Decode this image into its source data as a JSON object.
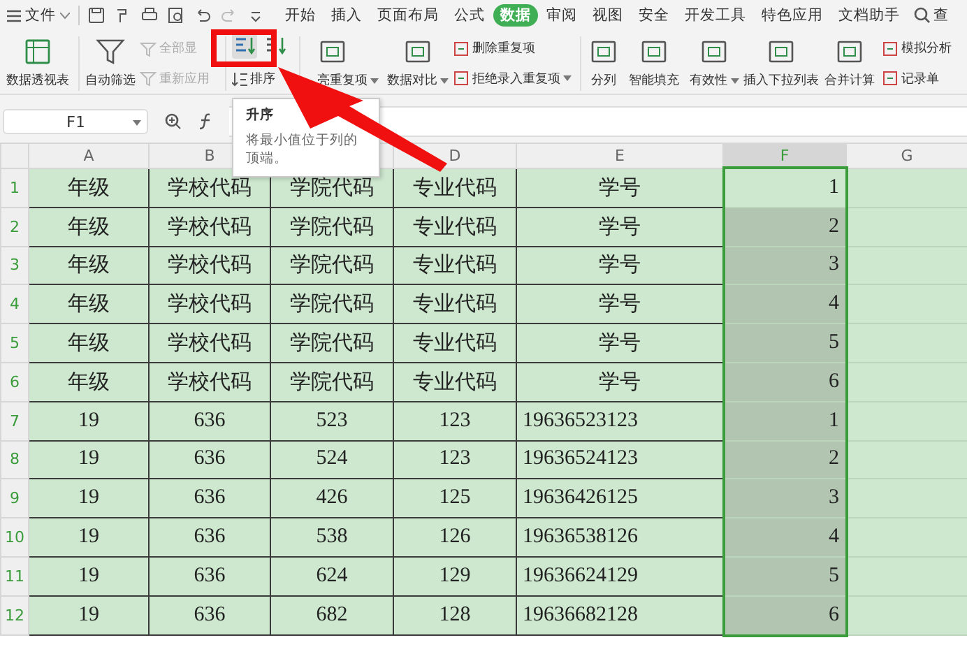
{
  "menu": {
    "label": "文件"
  },
  "tabs": [
    {
      "label": "开始",
      "selected": false
    },
    {
      "label": "插入",
      "selected": false
    },
    {
      "label": "页面布局",
      "selected": false
    },
    {
      "label": "公式",
      "selected": false
    },
    {
      "label": "数据",
      "selected": true
    },
    {
      "label": "审阅",
      "selected": false
    },
    {
      "label": "视图",
      "selected": false
    },
    {
      "label": "安全",
      "selected": false
    },
    {
      "label": "开发工具",
      "selected": false
    },
    {
      "label": "特色应用",
      "selected": false
    },
    {
      "label": "文档助手",
      "selected": false
    }
  ],
  "search": {
    "label": "查"
  },
  "ribbon": [
    {
      "kind": "large",
      "label": "数据透视表",
      "dropdown": false
    },
    {
      "kind": "large",
      "label": "自动筛选",
      "dropdown": false
    },
    {
      "kind": "stack",
      "items": [
        {
          "label": "全部显",
          "disabled": true,
          "dropdown": false
        },
        {
          "label": "重新应用",
          "disabled": true,
          "dropdown": false
        }
      ]
    },
    {
      "kind": "sort",
      "label": "排序"
    },
    {
      "kind": "large",
      "label": "亮重复项",
      "dropdown": true
    },
    {
      "kind": "large",
      "label": "数据对比",
      "dropdown": true
    },
    {
      "kind": "stack",
      "items": [
        {
          "label": "删除重复项",
          "disabled": false,
          "dropdown": false
        },
        {
          "label": "拒绝录入重复项",
          "disabled": false,
          "dropdown": true
        }
      ]
    },
    {
      "kind": "large",
      "label": "分列",
      "dropdown": false
    },
    {
      "kind": "large",
      "label": "智能填充",
      "dropdown": false
    },
    {
      "kind": "large",
      "label": "有效性",
      "dropdown": true
    },
    {
      "kind": "large",
      "label": "插入下拉列表",
      "dropdown": false
    },
    {
      "kind": "large",
      "label": "合并计算",
      "dropdown": false
    },
    {
      "kind": "stack",
      "items": [
        {
          "label": "模拟分析",
          "disabled": false,
          "dropdown": false
        },
        {
          "label": "记录单",
          "disabled": false,
          "dropdown": false
        }
      ]
    }
  ],
  "name_box": {
    "value": "F1"
  },
  "tooltip": {
    "title": "升序",
    "text": "将最小值位于列的顶端。"
  },
  "columns": [
    {
      "label": "A",
      "selected": false
    },
    {
      "label": "B",
      "selected": false
    },
    {
      "selected": false
    },
    {
      "label": "D",
      "selected": false
    },
    {
      "label": "E",
      "selected": false
    },
    {
      "label": "F",
      "selected": true
    },
    {
      "label": "G",
      "selected": false
    }
  ],
  "rows": [
    {
      "label": "1",
      "kind": "text",
      "selected": true,
      "cells": [
        "年级",
        "学校代码",
        "学院代码",
        "专业代码",
        "学号",
        "1"
      ]
    },
    {
      "label": "2",
      "kind": "text",
      "selected": true,
      "cells": [
        "年级",
        "学校代码",
        "学院代码",
        "专业代码",
        "学号",
        "2"
      ]
    },
    {
      "label": "3",
      "kind": "text",
      "selected": true,
      "cells": [
        "年级",
        "学校代码",
        "学院代码",
        "专业代码",
        "学号",
        "3"
      ]
    },
    {
      "label": "4",
      "kind": "text",
      "selected": true,
      "cells": [
        "年级",
        "学校代码",
        "学院代码",
        "专业代码",
        "学号",
        "4"
      ]
    },
    {
      "label": "5",
      "kind": "text",
      "selected": true,
      "cells": [
        "年级",
        "学校代码",
        "学院代码",
        "专业代码",
        "学号",
        "5"
      ]
    },
    {
      "label": "6",
      "kind": "text",
      "selected": true,
      "cells": [
        "年级",
        "学校代码",
        "学院代码",
        "专业代码",
        "学号",
        "6"
      ]
    },
    {
      "label": "7",
      "kind": "number",
      "selected": true,
      "cells": [
        "19",
        "636",
        "523",
        "123",
        "19636523123",
        "1"
      ]
    },
    {
      "label": "8",
      "kind": "number",
      "selected": true,
      "cells": [
        "19",
        "636",
        "524",
        "123",
        "19636524123",
        "2"
      ]
    },
    {
      "label": "9",
      "kind": "number",
      "selected": true,
      "cells": [
        "19",
        "636",
        "426",
        "125",
        "19636426125",
        "3"
      ]
    },
    {
      "label": "10",
      "kind": "number",
      "selected": true,
      "cells": [
        "19",
        "636",
        "538",
        "126",
        "19636538126",
        "4"
      ]
    },
    {
      "label": "11",
      "kind": "number",
      "selected": true,
      "cells": [
        "19",
        "636",
        "624",
        "129",
        "19636624129",
        "5"
      ]
    },
    {
      "label": "12",
      "kind": "number",
      "selected": true,
      "cells": [
        "19",
        "636",
        "682",
        "128",
        "19636682128",
        "6"
      ]
    }
  ]
}
